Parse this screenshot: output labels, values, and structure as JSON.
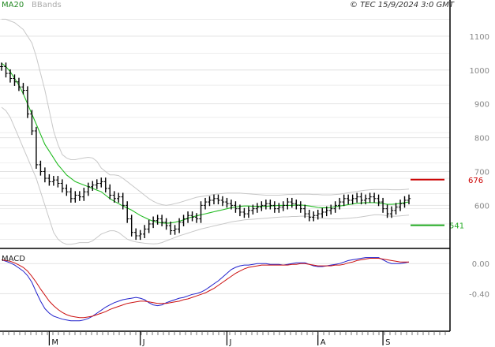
{
  "header": {
    "legend": [
      {
        "label": "MA20",
        "color": "#22bb22"
      },
      {
        "label": "BBands",
        "color": "#bbbbbb"
      }
    ],
    "copyright": "© TEC 15/9/2024 3:0 GMT"
  },
  "colors": {
    "price": "#000000",
    "ma20": "#22bb22",
    "bbands": "#c8c8c8",
    "grid": "#e2e2e2",
    "resistance": "#cc0000",
    "support": "#22aa22",
    "macd": "#2222cc",
    "signal": "#cc1111",
    "background": "#ffffff"
  },
  "chart_data": [
    {
      "type": "line",
      "panel": "price",
      "y_ticks": [
        "1100",
        "1000",
        "900",
        "800",
        "700",
        "600"
      ],
      "ylim": [
        475,
        1165
      ],
      "x_labels": [
        "M",
        "J",
        "J",
        "A",
        "S"
      ],
      "levels": [
        {
          "label": "676",
          "value": 676,
          "kind": "resistance"
        },
        {
          "label": "541",
          "value": 541,
          "kind": "support"
        }
      ],
      "series": {
        "close": [
          1010,
          990,
          975,
          965,
          950,
          940,
          870,
          820,
          720,
          700,
          680,
          670,
          675,
          665,
          650,
          640,
          620,
          630,
          625,
          640,
          655,
          660,
          665,
          670,
          650,
          630,
          620,
          625,
          600,
          560,
          520,
          510,
          515,
          530,
          545,
          555,
          560,
          550,
          540,
          525,
          530,
          550,
          560,
          570,
          565,
          560,
          600,
          610,
          615,
          620,
          615,
          610,
          605,
          600,
          590,
          580,
          575,
          585,
          590,
          595,
          600,
          605,
          600,
          590,
          595,
          600,
          610,
          605,
          600,
          590,
          575,
          565,
          570,
          575,
          580,
          585,
          590,
          600,
          610,
          620,
          615,
          620,
          625,
          615,
          620,
          625,
          620,
          610,
          590,
          575,
          585,
          595,
          605,
          615,
          620
        ],
        "ma20": [
          1020,
          1010,
          995,
          975,
          955,
          930,
          900,
          870,
          840,
          810,
          780,
          760,
          740,
          720,
          705,
          690,
          680,
          670,
          665,
          660,
          655,
          650,
          645,
          640,
          630,
          620,
          612,
          605,
          598,
          592,
          586,
          578,
          570,
          564,
          558,
          553,
          550,
          548,
          547,
          548,
          550,
          553,
          557,
          562,
          566,
          569,
          572,
          575,
          578,
          581,
          584,
          587,
          590,
          593,
          595,
          597,
          598,
          598,
          597,
          597,
          597,
          597,
          598,
          599,
          600,
          600,
          600,
          600,
          601,
          601,
          600,
          598,
          596,
          594,
          593,
          593,
          594,
          596,
          598,
          600,
          602,
          604,
          606,
          607,
          608,
          608,
          608,
          607,
          605,
          603,
          603,
          604,
          606,
          608,
          610
        ],
        "bb_upper": [
          1150,
          1150,
          1145,
          1140,
          1130,
          1120,
          1100,
          1080,
          1040,
          990,
          940,
          880,
          820,
          780,
          750,
          740,
          735,
          735,
          738,
          740,
          742,
          740,
          730,
          710,
          700,
          690,
          690,
          688,
          680,
          670,
          660,
          650,
          640,
          630,
          620,
          612,
          606,
          602,
          600,
          602,
          605,
          608,
          612,
          616,
          620,
          624,
          626,
          628,
          630,
          632,
          634,
          635,
          636,
          636,
          636,
          636,
          635,
          634,
          633,
          632,
          631,
          630,
          630,
          630,
          630,
          631,
          632,
          632,
          633,
          633,
          633,
          633,
          632,
          632,
          631,
          631,
          631,
          632,
          633,
          635,
          637,
          639,
          641,
          643,
          645,
          646,
          647,
          647,
          647,
          647,
          646,
          646,
          646,
          647,
          648
        ],
        "bb_lower": [
          890,
          880,
          860,
          830,
          800,
          770,
          740,
          710,
          680,
          640,
          600,
          560,
          520,
          500,
          490,
          485,
          485,
          487,
          490,
          490,
          490,
          495,
          505,
          515,
          520,
          525,
          525,
          520,
          510,
          500,
          495,
          492,
          490,
          488,
          487,
          486,
          487,
          490,
          495,
          500,
          505,
          510,
          514,
          518,
          522,
          526,
          530,
          533,
          536,
          539,
          542,
          545,
          548,
          551,
          553,
          555,
          557,
          558,
          559,
          560,
          561,
          562,
          563,
          564,
          565,
          566,
          566,
          567,
          567,
          568,
          568,
          567,
          565,
          563,
          562,
          561,
          560,
          560,
          560,
          561,
          562,
          563,
          564,
          566,
          568,
          570,
          572,
          572,
          571,
          569,
          568,
          568,
          569,
          570,
          571
        ]
      }
    },
    {
      "type": "line",
      "panel": "macd",
      "title": "MACD",
      "y_ticks": [
        "0.00",
        "-0.40"
      ],
      "ylim": [
        -0.9,
        0.17
      ],
      "series": [
        {
          "name": "MACD",
          "values": [
            0.05,
            0.03,
            0.01,
            -0.02,
            -0.06,
            -0.1,
            -0.16,
            -0.25,
            -0.38,
            -0.5,
            -0.6,
            -0.66,
            -0.7,
            -0.72,
            -0.74,
            -0.75,
            -0.76,
            -0.76,
            -0.76,
            -0.75,
            -0.73,
            -0.7,
            -0.66,
            -0.62,
            -0.58,
            -0.55,
            -0.52,
            -0.5,
            -0.48,
            -0.47,
            -0.46,
            -0.45,
            -0.46,
            -0.48,
            -0.52,
            -0.55,
            -0.56,
            -0.55,
            -0.52,
            -0.5,
            -0.48,
            -0.46,
            -0.45,
            -0.43,
            -0.41,
            -0.4,
            -0.38,
            -0.35,
            -0.31,
            -0.27,
            -0.23,
            -0.18,
            -0.13,
            -0.08,
            -0.05,
            -0.03,
            -0.02,
            -0.02,
            -0.01,
            0.0,
            0.0,
            0.0,
            -0.01,
            -0.01,
            -0.01,
            -0.02,
            -0.01,
            0.0,
            0.01,
            0.01,
            0.01,
            -0.01,
            -0.03,
            -0.04,
            -0.04,
            -0.03,
            -0.02,
            -0.01,
            0.0,
            0.02,
            0.04,
            0.05,
            0.06,
            0.07,
            0.08,
            0.08,
            0.08,
            0.08,
            0.05,
            0.02,
            0.0,
            0.0,
            0.0,
            0.01,
            0.02
          ]
        },
        {
          "name": "Signal",
          "values": [
            0.05,
            0.04,
            0.03,
            0.01,
            -0.02,
            -0.05,
            -0.1,
            -0.17,
            -0.25,
            -0.34,
            -0.42,
            -0.5,
            -0.56,
            -0.61,
            -0.65,
            -0.68,
            -0.7,
            -0.71,
            -0.72,
            -0.72,
            -0.71,
            -0.7,
            -0.68,
            -0.66,
            -0.64,
            -0.61,
            -0.59,
            -0.57,
            -0.55,
            -0.53,
            -0.52,
            -0.51,
            -0.5,
            -0.5,
            -0.51,
            -0.52,
            -0.53,
            -0.53,
            -0.53,
            -0.52,
            -0.51,
            -0.5,
            -0.48,
            -0.47,
            -0.45,
            -0.43,
            -0.41,
            -0.39,
            -0.36,
            -0.33,
            -0.29,
            -0.25,
            -0.21,
            -0.17,
            -0.13,
            -0.1,
            -0.07,
            -0.05,
            -0.04,
            -0.03,
            -0.02,
            -0.02,
            -0.02,
            -0.02,
            -0.02,
            -0.02,
            -0.02,
            -0.01,
            -0.01,
            0.0,
            0.0,
            -0.01,
            -0.02,
            -0.03,
            -0.03,
            -0.03,
            -0.03,
            -0.02,
            -0.02,
            -0.01,
            0.01,
            0.02,
            0.04,
            0.05,
            0.06,
            0.07,
            0.07,
            0.07,
            0.06,
            0.05,
            0.04,
            0.03,
            0.02,
            0.02,
            0.02
          ]
        }
      ]
    }
  ]
}
